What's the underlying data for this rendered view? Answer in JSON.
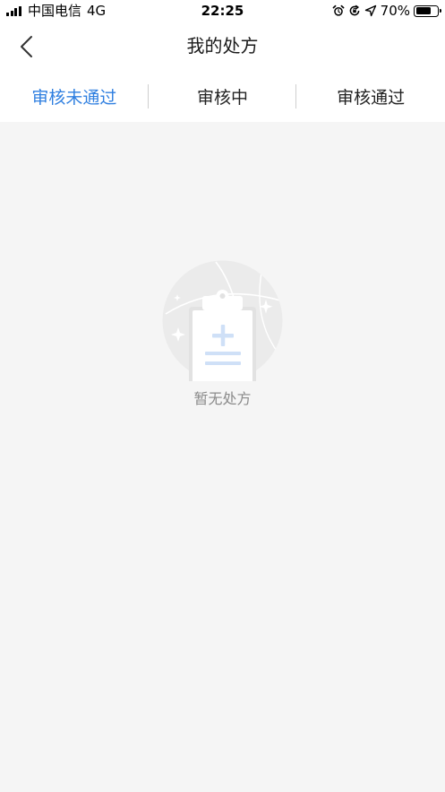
{
  "status_bar": {
    "carrier": "中国电信",
    "network": "4G",
    "time": "22:25",
    "battery_percent": "70%",
    "battery_level": 0.7
  },
  "nav": {
    "title": "我的处方"
  },
  "tabs": [
    {
      "label": "审核未通过",
      "active": true
    },
    {
      "label": "审核中",
      "active": false
    },
    {
      "label": "审核通过",
      "active": false
    }
  ],
  "empty_state": {
    "message": "暂无处方",
    "icon": "clipboard-plus-icon"
  },
  "colors": {
    "accent": "#2f7fe0",
    "background": "#f5f5f5",
    "text_primary": "#222222",
    "text_muted": "#8a8a8a"
  }
}
